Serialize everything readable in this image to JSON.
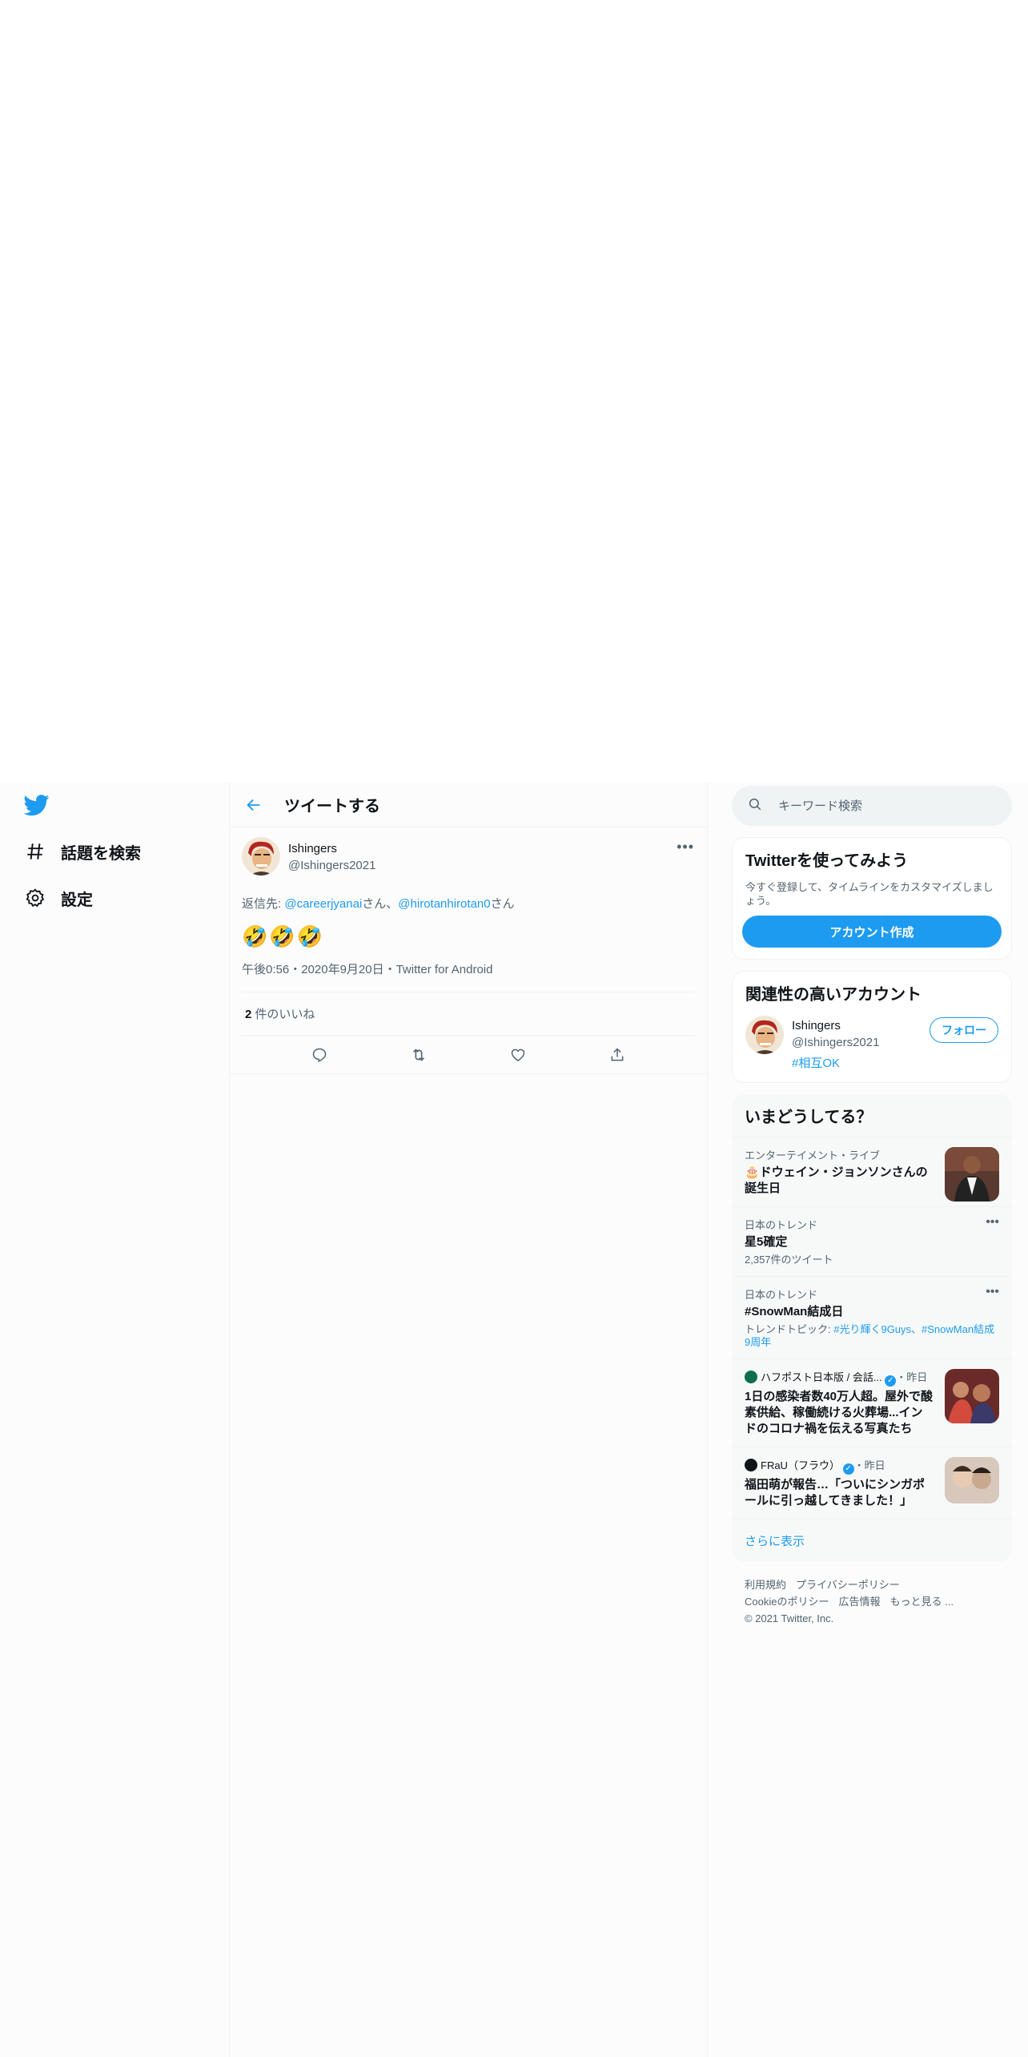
{
  "nav": {
    "items": [
      {
        "label": "話題を検索",
        "icon": "hashtag-icon"
      },
      {
        "label": "設定",
        "icon": "gear-icon"
      }
    ]
  },
  "header": {
    "title": "ツイートする"
  },
  "tweet": {
    "display_name": "Ishingers",
    "handle": "@Ishingers2021",
    "reply_prefix": "返信先: ",
    "reply_mention_1": "@careerjyanai",
    "reply_suffix_1": "さん、",
    "reply_mention_2": "@hirotanhirotan0",
    "reply_suffix_2": "さん",
    "text": "🤣🤣🤣",
    "meta": "午後0:56・2020年9月20日・Twitter for Android",
    "likes_count": "2",
    "likes_label": "件のいいね"
  },
  "search": {
    "placeholder": "キーワード検索"
  },
  "signup": {
    "title": "Twitterを使ってみよう",
    "desc": "今すぐ登録して、タイムラインをカスタマイズしましょう。",
    "button": "アカウント作成"
  },
  "relevant": {
    "title": "関連性の高いアカウント",
    "name": "Ishingers",
    "handle": "@Ishingers2021",
    "tag": "#相互OK",
    "follow": "フォロー"
  },
  "trends": {
    "title": "いまどうしてる？",
    "items": [
      {
        "meta": "エンターテイメント・ライブ",
        "title": "🎂ドウェイン・ジョンソンさんの誕生日"
      },
      {
        "meta": "日本のトレンド",
        "title": "星5確定",
        "sub": "2,357件のツイート"
      },
      {
        "meta": "日本のトレンド",
        "title": "#SnowMan結成日",
        "sub_prefix": "トレンドトピック: ",
        "sub_tags": "#光り輝く9Guys、#SnowMan結成9周年"
      },
      {
        "source": "ハフポスト日本版 / 会話...",
        "time": "・昨日",
        "title": "1日の感染者数40万人超。屋外で酸素供給、稼働続ける火葬場...インドのコロナ禍を伝える写真たち"
      },
      {
        "source": "FRaU（フラウ）",
        "time": "・昨日",
        "title": "福田萌が報告…「ついにシンガポールに引っ越してきました！」"
      }
    ],
    "show_more": "さらに表示"
  },
  "footer": {
    "terms": "利用規約",
    "privacy": "プライバシーポリシー",
    "cookie": "Cookieのポリシー",
    "ads": "広告情報",
    "more": "もっと見る ...",
    "copyright": "© 2021 Twitter, Inc."
  },
  "colors": {
    "accent": "#1d9bf0",
    "text": "#0f1419",
    "muted": "#536471"
  }
}
